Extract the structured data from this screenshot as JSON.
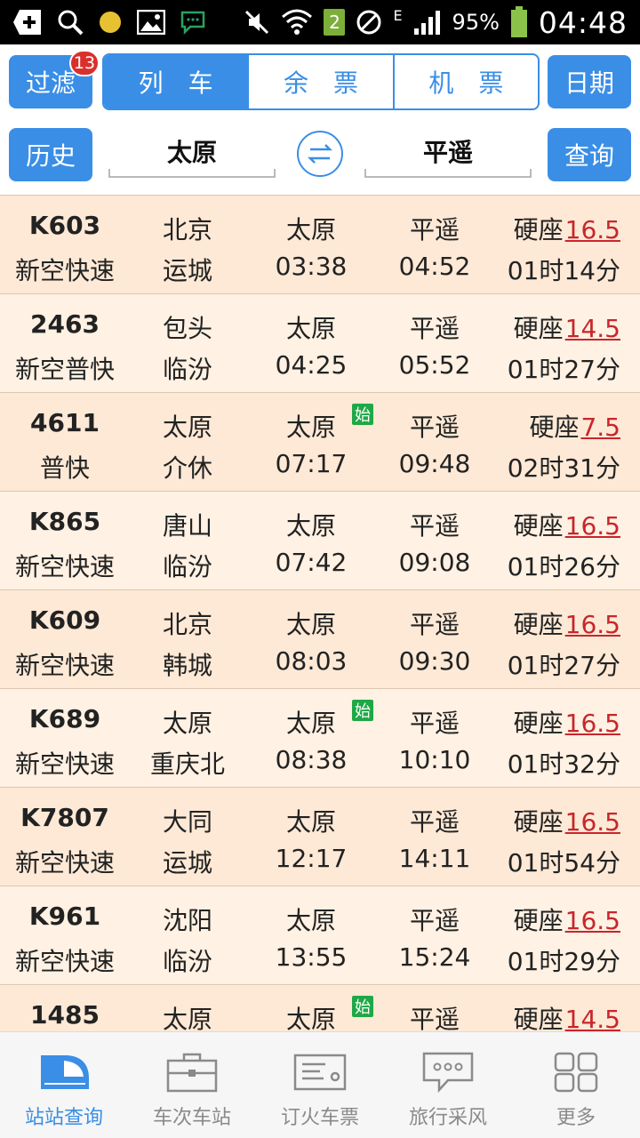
{
  "status_bar": {
    "battery_percent": "95%",
    "clock": "04:48",
    "sim_badge": "2",
    "network_letter": "E"
  },
  "toolbar": {
    "filter_label": "过滤",
    "filter_badge_count": "13",
    "tabs": [
      {
        "label": "列车",
        "active": true
      },
      {
        "label": "余票",
        "active": false
      },
      {
        "label": "机票",
        "active": false
      }
    ],
    "date_label": "日期"
  },
  "search": {
    "history_label": "历史",
    "from_station": "太原",
    "to_station": "平遥",
    "query_label": "查询"
  },
  "trains": [
    {
      "no": "K603",
      "type": "新空快速",
      "start": "北京",
      "end": "运城",
      "from": "太原",
      "depart": "03:38",
      "to": "平遥",
      "arrive": "04:52",
      "seat": "硬座",
      "price": "16.5",
      "duration": "01时14分",
      "origin_marker": ""
    },
    {
      "no": "2463",
      "type": "新空普快",
      "start": "包头",
      "end": "临汾",
      "from": "太原",
      "depart": "04:25",
      "to": "平遥",
      "arrive": "05:52",
      "seat": "硬座",
      "price": "14.5",
      "duration": "01时27分",
      "origin_marker": ""
    },
    {
      "no": "4611",
      "type": "普快",
      "start": "太原",
      "end": "介休",
      "from": "太原",
      "depart": "07:17",
      "to": "平遥",
      "arrive": "09:48",
      "seat": "硬座",
      "price": "7.5",
      "duration": "02时31分",
      "origin_marker": "始"
    },
    {
      "no": "K865",
      "type": "新空快速",
      "start": "唐山",
      "end": "临汾",
      "from": "太原",
      "depart": "07:42",
      "to": "平遥",
      "arrive": "09:08",
      "seat": "硬座",
      "price": "16.5",
      "duration": "01时26分",
      "origin_marker": ""
    },
    {
      "no": "K609",
      "type": "新空快速",
      "start": "北京",
      "end": "韩城",
      "from": "太原",
      "depart": "08:03",
      "to": "平遥",
      "arrive": "09:30",
      "seat": "硬座",
      "price": "16.5",
      "duration": "01时27分",
      "origin_marker": ""
    },
    {
      "no": "K689",
      "type": "新空快速",
      "start": "太原",
      "end": "重庆北",
      "from": "太原",
      "depart": "08:38",
      "to": "平遥",
      "arrive": "10:10",
      "seat": "硬座",
      "price": "16.5",
      "duration": "01时32分",
      "origin_marker": "始"
    },
    {
      "no": "K7807",
      "type": "新空快速",
      "start": "大同",
      "end": "运城",
      "from": "太原",
      "depart": "12:17",
      "to": "平遥",
      "arrive": "14:11",
      "seat": "硬座",
      "price": "16.5",
      "duration": "01时54分",
      "origin_marker": ""
    },
    {
      "no": "K961",
      "type": "新空快速",
      "start": "沈阳",
      "end": "临汾",
      "from": "太原",
      "depart": "13:55",
      "to": "平遥",
      "arrive": "15:24",
      "seat": "硬座",
      "price": "16.5",
      "duration": "01时29分",
      "origin_marker": ""
    },
    {
      "no": "1485",
      "type": "",
      "start": "太原",
      "end": "",
      "from": "太原",
      "depart": "",
      "to": "平遥",
      "arrive": "",
      "seat": "硬座",
      "price": "14.5",
      "duration": "",
      "origin_marker": "始"
    }
  ],
  "bottom_nav": [
    {
      "label": "站站查询",
      "icon": "train-icon",
      "active": true
    },
    {
      "label": "车次车站",
      "icon": "briefcase-icon",
      "active": false
    },
    {
      "label": "订火车票",
      "icon": "ticket-icon",
      "active": false
    },
    {
      "label": "旅行采风",
      "icon": "chat-bubble-icon",
      "active": false
    },
    {
      "label": "更多",
      "icon": "grid-icon",
      "active": false
    }
  ],
  "colors": {
    "accent": "#3a8ee6",
    "price": "#c8262b",
    "row_odd": "#fde9d6",
    "row_even": "#fff1e3",
    "origin_badge": "#1fa845",
    "filter_badge": "#d9302c"
  }
}
